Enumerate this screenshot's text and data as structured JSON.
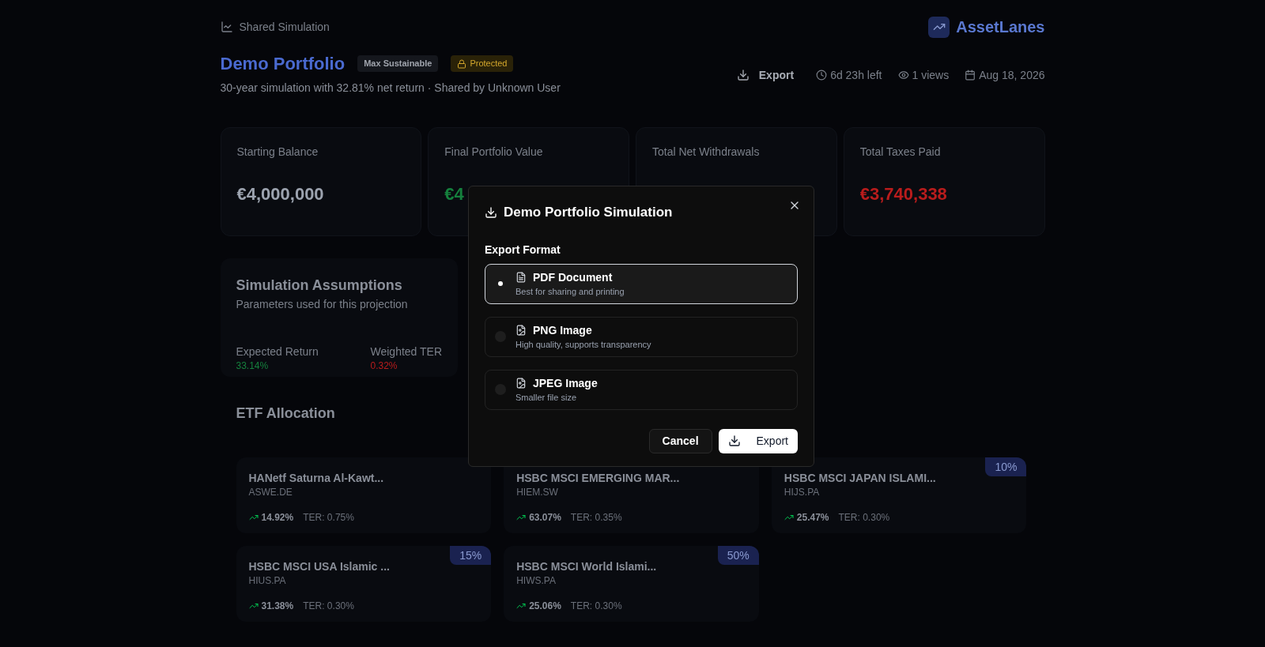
{
  "header": {
    "breadcrumb": "Shared Simulation",
    "brand": "AssetLanes",
    "title": "Demo Portfolio",
    "badges": [
      {
        "label": "Max Sustainable",
        "kind": "plain"
      },
      {
        "label": "Protected",
        "kind": "lock"
      }
    ],
    "subtitle": "30-year simulation with 32.81% net return · Shared by Unknown User",
    "export": "Export",
    "time_left": "6d 23h left",
    "views": "1 views",
    "date": "Aug 18, 2026"
  },
  "stats": [
    {
      "label": "Starting Balance",
      "value": "€4,000,000",
      "color": "#9ca3af"
    },
    {
      "label": "Final Portfolio Value",
      "value": "€4",
      "color": "#15803d"
    },
    {
      "label": "Total Net Withdrawals"
    },
    {
      "label": "Total Taxes Paid",
      "value": "€3,740,338",
      "color": "#b91c1c"
    }
  ],
  "assumptions": {
    "title": "Simulation Assumptions",
    "subtitle": "Parameters used for this projection",
    "items": [
      {
        "label": "Expected Return",
        "value": "33.14%",
        "color": "#15803d"
      },
      {
        "label": "Weighted TER",
        "value": "0.32%",
        "color": "#b91c1c"
      }
    ]
  },
  "allocation": {
    "title": "ETF Allocation",
    "etfs": [
      {
        "name": "HANetf Saturna Al-Kawt...",
        "ticker": "ASWE.DE",
        "return": "14.92%",
        "ter": "TER: 0.75%"
      },
      {
        "name": "HSBC MSCI EMERGING MAR...",
        "ticker": "HIEM.SW",
        "return": "63.07%",
        "ter": "TER: 0.35%"
      },
      {
        "name": "HSBC MSCI JAPAN ISLAMI...",
        "ticker": "HIJS.PA",
        "return": "25.47%",
        "ter": "TER: 0.30%",
        "weight": "10%"
      },
      {
        "name": "HSBC MSCI USA Islamic ...",
        "ticker": "HIUS.PA",
        "return": "31.38%",
        "ter": "TER: 0.30%",
        "weight": "15%"
      },
      {
        "name": "HSBC MSCI World Islami...",
        "ticker": "HIWS.PA",
        "return": "25.06%",
        "ter": "TER: 0.30%",
        "weight": "50%"
      }
    ]
  },
  "dialog": {
    "title": "Demo Portfolio Simulation",
    "section": "Export Format",
    "options": [
      {
        "label": "PDF Document",
        "description": "Best for sharing and printing",
        "kind": "document",
        "selected": true
      },
      {
        "label": "PNG Image",
        "description": "High quality, supports transparency",
        "kind": "image",
        "selected": false
      },
      {
        "label": "JPEG Image",
        "description": "Smaller file size",
        "kind": "image",
        "selected": false
      }
    ],
    "cancel": "Cancel",
    "confirm": "Export"
  }
}
